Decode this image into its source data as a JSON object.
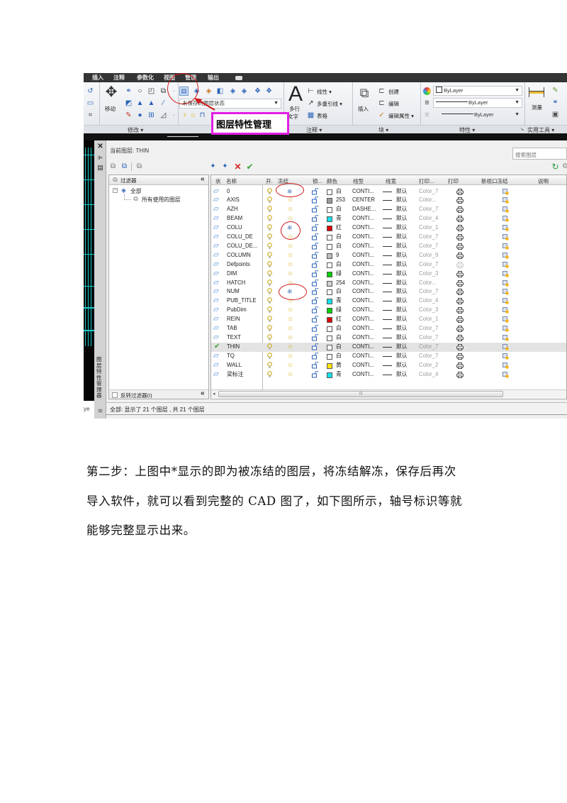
{
  "ribbon": {
    "tabs": [
      "插入",
      "注释",
      "参数化",
      "视图",
      "管理",
      "输出"
    ],
    "modify": {
      "move_label": "移动",
      "panel_label": "修改 ▾"
    },
    "layers": {
      "state_dropdown": "未保存的图层状态"
    },
    "annotation": {
      "mtext_line1": "多行",
      "mtext_line2": "文字",
      "linear": "线性 ▾",
      "mleader": "多重引线 ▾",
      "table": "表格",
      "panel_label": "注释 ▾"
    },
    "block": {
      "insert": "插入",
      "create": "创建",
      "edit": "编辑",
      "edit_attributes": "编辑属性 ▾",
      "panel_label": "块 ▾"
    },
    "properties": {
      "color": "ByLayer",
      "linetype": "ByLayer",
      "lineweight": "ByLayer",
      "panel_label": "特性 ▾"
    },
    "utilities": {
      "measure": "测量",
      "panel_label": "实用工具 ▾"
    }
  },
  "callout": {
    "text": "图层特性管理"
  },
  "left_stub_text": "ye",
  "layer_manager": {
    "palette_title": "图层特性管理器",
    "current_layer": "当前图层: THIN",
    "search_placeholder": "搜索图层",
    "filters": {
      "header": "过滤器",
      "collapse": "«",
      "tree_root": "全部",
      "tree_child": "所有使用的图层",
      "invert_label": "反转过滤器(I)",
      "invert_checked": false
    },
    "columns": [
      "状",
      "名称",
      "开.",
      "冻结",
      "锁...",
      "颜色",
      "线型",
      "线宽",
      "打印...",
      "打印",
      "新视口冻结",
      "说明"
    ],
    "layers": [
      {
        "name": "0",
        "current": false,
        "frozen": true,
        "swatch": "#ffffff",
        "color": "白",
        "linetype": "CONTI...",
        "lineweight": "默认",
        "plot_style": "Color_7",
        "plot": true
      },
      {
        "name": "AXIS",
        "current": false,
        "frozen": false,
        "swatch": "#9a9a9a",
        "color": "253",
        "linetype": "CENTER",
        "lineweight": "默认",
        "plot_style": "Color...",
        "plot": true
      },
      {
        "name": "AZH",
        "current": false,
        "frozen": false,
        "swatch": "#ffffff",
        "color": "白",
        "linetype": "DASHE...",
        "lineweight": "默认",
        "plot_style": "Color_7",
        "plot": true
      },
      {
        "name": "BEAM",
        "current": false,
        "frozen": false,
        "swatch": "#12e0ea",
        "color": "青",
        "linetype": "CONTI...",
        "lineweight": "默认",
        "plot_style": "Color_4",
        "plot": true
      },
      {
        "name": "COLU",
        "current": false,
        "frozen": true,
        "swatch": "#e00000",
        "color": "红",
        "linetype": "CONTI...",
        "lineweight": "默认",
        "plot_style": "Color_1",
        "plot": true
      },
      {
        "name": "COLU_DE",
        "current": false,
        "frozen": false,
        "swatch": "#ffffff",
        "color": "白",
        "linetype": "CONTI...",
        "lineweight": "默认",
        "plot_style": "Color_7",
        "plot": true
      },
      {
        "name": "COLU_DE...",
        "current": false,
        "frozen": false,
        "swatch": "#ffffff",
        "color": "白",
        "linetype": "CONTI...",
        "lineweight": "默认",
        "plot_style": "Color_7",
        "plot": true
      },
      {
        "name": "COLUMN",
        "current": false,
        "frozen": false,
        "swatch": "#bdbdbd",
        "color": "9",
        "linetype": "CONTI...",
        "lineweight": "默认",
        "plot_style": "Color_9",
        "plot": true
      },
      {
        "name": "Defpoints",
        "current": false,
        "frozen": false,
        "swatch": "#ffffff",
        "color": "白",
        "linetype": "CONTI...",
        "lineweight": "默认",
        "plot_style": "Color_7",
        "plot": false
      },
      {
        "name": "DIM",
        "current": false,
        "frozen": false,
        "swatch": "#00d000",
        "color": "绿",
        "linetype": "CONTI...",
        "lineweight": "默认",
        "plot_style": "Color_3",
        "plot": true
      },
      {
        "name": "HATCH",
        "current": false,
        "frozen": false,
        "swatch": "#cfcfcf",
        "color": "254",
        "linetype": "CONTI...",
        "lineweight": "默认",
        "plot_style": "Color...",
        "plot": true
      },
      {
        "name": "NUM",
        "current": false,
        "frozen": true,
        "swatch": "#ffffff",
        "color": "白",
        "linetype": "CONTI...",
        "lineweight": "默认",
        "plot_style": "Color_7",
        "plot": true
      },
      {
        "name": "PUB_TITLE",
        "current": false,
        "frozen": false,
        "swatch": "#12e0ea",
        "color": "青",
        "linetype": "CONTI...",
        "lineweight": "默认",
        "plot_style": "Color_4",
        "plot": true
      },
      {
        "name": "PubDim",
        "current": false,
        "frozen": false,
        "swatch": "#00d000",
        "color": "绿",
        "linetype": "CONTI...",
        "lineweight": "默认",
        "plot_style": "Color_3",
        "plot": true
      },
      {
        "name": "REIN",
        "current": false,
        "frozen": false,
        "swatch": "#e00000",
        "color": "红",
        "linetype": "CONTI...",
        "lineweight": "默认",
        "plot_style": "Color_1",
        "plot": true
      },
      {
        "name": "TAB",
        "current": false,
        "frozen": false,
        "swatch": "#ffffff",
        "color": "白",
        "linetype": "CONTI...",
        "lineweight": "默认",
        "plot_style": "Color_7",
        "plot": true
      },
      {
        "name": "TEXT",
        "current": false,
        "frozen": false,
        "swatch": "#ffffff",
        "color": "白",
        "linetype": "CONTI...",
        "lineweight": "默认",
        "plot_style": "Color_7",
        "plot": true
      },
      {
        "name": "THIN",
        "current": true,
        "frozen": false,
        "swatch": "#ffffff",
        "color": "白",
        "linetype": "CONTI...",
        "lineweight": "默认",
        "plot_style": "Color_7",
        "plot": true
      },
      {
        "name": "TQ",
        "current": false,
        "frozen": false,
        "swatch": "#ffffff",
        "color": "白",
        "linetype": "CONTI...",
        "lineweight": "默认",
        "plot_style": "Color_7",
        "plot": true
      },
      {
        "name": "WALL",
        "current": false,
        "frozen": false,
        "swatch": "#ffe600",
        "color": "黄",
        "linetype": "CONTI...",
        "lineweight": "默认",
        "plot_style": "Color_2",
        "plot": true
      },
      {
        "name": "梁标注",
        "current": false,
        "frozen": false,
        "swatch": "#12e0ea",
        "color": "青",
        "linetype": "CONTI...",
        "lineweight": "默认",
        "plot_style": "Color_4",
        "plot": true
      }
    ],
    "status": "全部: 显示了 21 个图层 , 共 21 个图层"
  },
  "paragraph": [
    "第二步：上图中*显示的即为被冻结的图层，将冻结解冻，保存后再次",
    "导入软件，就可以看到完整的 CAD 图了，如下图所示，轴号标识等就",
    "能够完整显示出来。"
  ]
}
